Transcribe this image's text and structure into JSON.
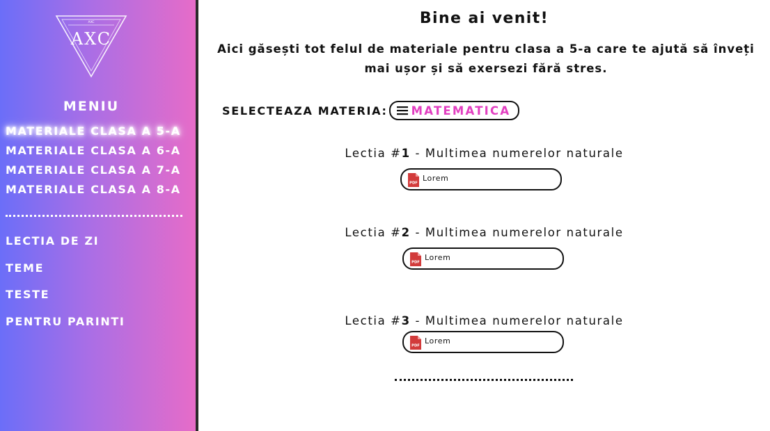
{
  "sidebar": {
    "logo": {
      "text": "AXC",
      "small_text": "AXC"
    },
    "menu_title": "MENIU",
    "class_items": [
      {
        "label": "MATERIALE CLASA A 5-A",
        "active": true
      },
      {
        "label": "MATERIALE CLASA A 6-A",
        "active": false
      },
      {
        "label": "MATERIALE CLASA A 7-A",
        "active": false
      },
      {
        "label": "MATERIALE CLASA A 8-A",
        "active": false
      }
    ],
    "nav_items": [
      {
        "label": "LECTIA DE ZI"
      },
      {
        "label": "TEME"
      },
      {
        "label": "TESTE"
      },
      {
        "label": "PENTRU PARINTI"
      }
    ]
  },
  "main": {
    "welcome": "Bine ai venit!",
    "intro": "Aici găsești tot felul de materiale pentru clasa a 5-a care te ajută să înveți mai ușor și să exersezi fără stres.",
    "select_label": "SELECTEAZA MATERIA:",
    "subject": "MATEMATICA",
    "lessons": [
      {
        "prefix": "Lectia #",
        "number": "1",
        "name": " - Multimea numerelor naturale",
        "file_label": "Lorem"
      },
      {
        "prefix": "Lectia #",
        "number": "2",
        "name": " - Multimea numerelor naturale",
        "file_label": "Lorem"
      },
      {
        "prefix": "Lectia #",
        "number": "3",
        "name": " - Multimea numerelor naturale",
        "file_label": "Lorem"
      }
    ]
  },
  "icons": {
    "file": "pdf-icon",
    "menu": "hamburger-icon",
    "pdf_badge_text": "PDF"
  },
  "colors": {
    "gradient_start": "#6b6ef8",
    "gradient_end": "#e66cc8",
    "accent": "#e23fc1",
    "pdf_red": "#d23b3b"
  }
}
